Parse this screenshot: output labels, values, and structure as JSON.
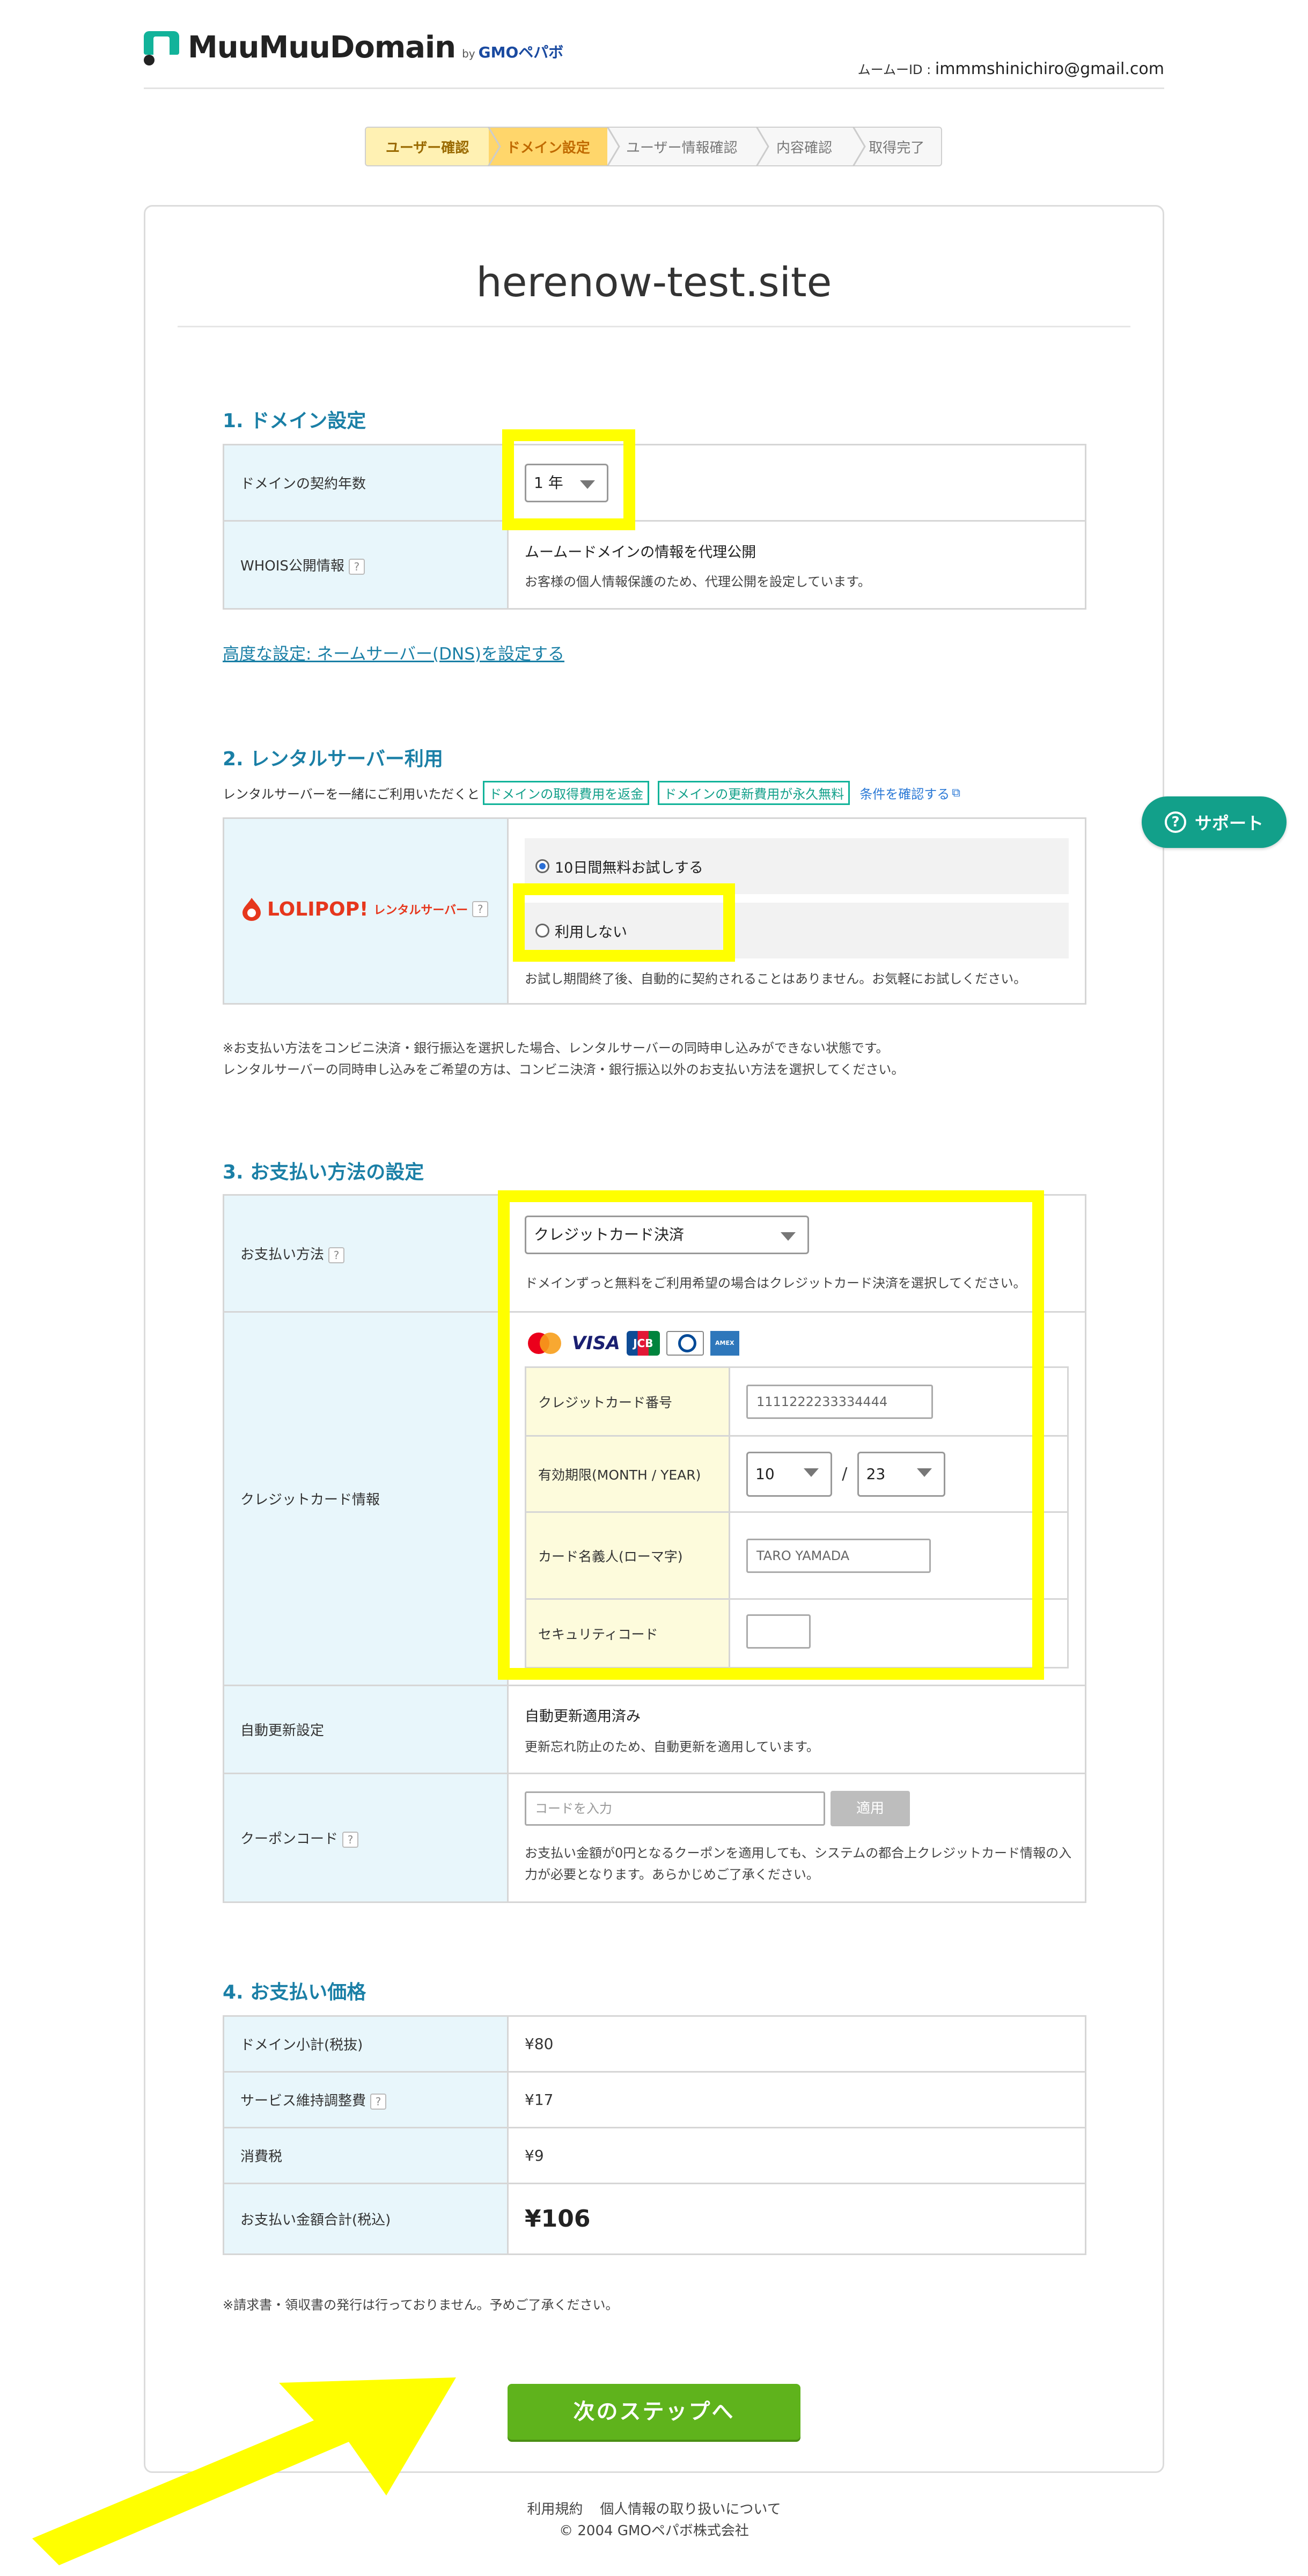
{
  "header": {
    "brand": "MuuMuuDomain",
    "by": "by",
    "gmo": "GMOペパボ",
    "user_id_label": "ムームーID : ",
    "user_id": "immmshinichiro@gmail.com"
  },
  "steps": [
    "ユーザー確認",
    "ドメイン設定",
    "ユーザー情報確認",
    "内容確認",
    "取得完了"
  ],
  "domain_name": "herenow-test.site",
  "section1": {
    "title": "1. ドメイン設定",
    "term_label": "ドメインの契約年数",
    "term_value": "1 年",
    "whois_label": "WHOIS公開情報",
    "whois_value": "ムームードメインの情報を代理公開",
    "whois_note": "お客様の個人情報保護のため、代理公開を設定しています。",
    "dns_link": "高度な設定: ネームサーバー(DNS)を設定する"
  },
  "section2": {
    "title": "2. レンタルサーバー利用",
    "intro": "レンタルサーバーを一緒にご利用いただくと",
    "badge1": "ドメインの取得費用を返金",
    "badge2": "ドメインの更新費用が永久無料",
    "conditions_link": "条件を確認する",
    "lolipop_brand": "LOLIPOP!",
    "lolipop_sub": "レンタルサーバー",
    "option1": "10日間無料お試しする",
    "option2": "利用しない",
    "trial_note": "お試し期間終了後、自動的に契約されることはありません。お気軽にお試しください。",
    "note_line1": "※お支払い方法をコンビニ決済・銀行振込を選択した場合、レンタルサーバーの同時申し込みができない状態です。",
    "note_line2": "レンタルサーバーの同時申し込みをご希望の方は、コンビニ決済・銀行振込以外のお支払い方法を選択してください。"
  },
  "section3": {
    "title": "3. お支払い方法の設定",
    "method_label": "お支払い方法",
    "method_value": "クレジットカード決済",
    "method_note": "ドメインずっと無料をご利用希望の場合はクレジットカード決済を選択してください。",
    "card_info_label": "クレジットカード情報",
    "card_number_label": "クレジットカード番号",
    "card_number_placeholder": "1111222233334444",
    "expiry_label": "有効期限(MONTH / YEAR)",
    "expiry_month": "10",
    "expiry_sep": "/",
    "expiry_year": "23",
    "holder_label": "カード名義人(ローマ字)",
    "holder_placeholder": "TARO YAMADA",
    "cvc_label": "セキュリティコード",
    "card_brands": [
      "mastercard",
      "VISA",
      "JCB",
      "Diners Club",
      "AMEX"
    ],
    "auto_renew_label": "自動更新設定",
    "auto_renew_value": "自動更新適用済み",
    "auto_renew_note": "更新忘れ防止のため、自動更新を適用しています。",
    "coupon_label": "クーポンコード",
    "coupon_placeholder": "コードを入力",
    "coupon_button": "適用",
    "coupon_note_line1": "お支払い金額が0円となるクーポンを適用しても、システムの都合上クレジットカード情報の入",
    "coupon_note_line2": "力が必要となります。あらかじめご了承ください。"
  },
  "section4": {
    "title": "4. お支払い価格",
    "rows": [
      {
        "label": "ドメイン小計(税抜)",
        "value": "¥80"
      },
      {
        "label": "サービス維持調整費",
        "value": "¥17"
      },
      {
        "label": "消費税",
        "value": "¥9"
      },
      {
        "label": "お支払い金額合計(税込)",
        "value": "¥106"
      }
    ],
    "note": "※請求書・領収書の発行は行っておりません。予めご了承ください。"
  },
  "next_button": "次のステップへ",
  "support_button": "サポート",
  "footer": {
    "terms": "利用規約",
    "privacy": "個人情報の取り扱いについて",
    "copyright": "© 2004 GMOペパボ株式会社"
  },
  "colors": {
    "accent": "#1a7fa6",
    "brand_green": "#12b39a",
    "next_button": "#5fb31c",
    "highlight": "#ffff00"
  }
}
